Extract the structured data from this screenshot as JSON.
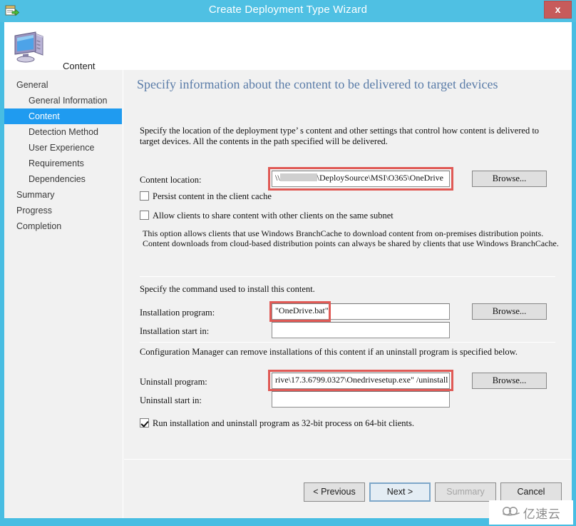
{
  "window": {
    "title": "Create Deployment Type Wizard",
    "title_icon": "deploy-package-icon",
    "close_label": "x"
  },
  "header": {
    "icon": "computer-monitor-icon",
    "label": "Content"
  },
  "sidebar": {
    "items": [
      {
        "label": "General",
        "level": 0,
        "selected": false
      },
      {
        "label": "General Information",
        "level": 1,
        "selected": false
      },
      {
        "label": "Content",
        "level": 1,
        "selected": true
      },
      {
        "label": "Detection Method",
        "level": 1,
        "selected": false
      },
      {
        "label": "User Experience",
        "level": 1,
        "selected": false
      },
      {
        "label": "Requirements",
        "level": 1,
        "selected": false
      },
      {
        "label": "Dependencies",
        "level": 1,
        "selected": false
      },
      {
        "label": "Summary",
        "level": 0,
        "selected": false
      },
      {
        "label": "Progress",
        "level": 0,
        "selected": false
      },
      {
        "label": "Completion",
        "level": 0,
        "selected": false
      }
    ]
  },
  "pane": {
    "title": "Specify information about the content to be delivered to target devices",
    "intro": "Specify the location of the deployment type’ s content and other settings that control how content is delivered to target devices. All the contents in the path specified will be delivered.",
    "content_location": {
      "label": "Content location:",
      "value_prefix": "\\\\",
      "value_suffix": "\\DeploySource\\MSI\\O365\\OneDrive",
      "browse_label": "Browse...",
      "highlighted": true
    },
    "persist_cache": {
      "label": "Persist content in the client cache",
      "checked": false
    },
    "share_subnet": {
      "label": "Allow clients to share content with other clients on the same subnet",
      "checked": false
    },
    "branchcache_help": "This option allows clients that use Windows BranchCache to download content from on-premises distribution points. Content downloads from cloud-based distribution points can always be shared by clients that use Windows BranchCache.",
    "install_section_help": "Specify the command used to install this content.",
    "installation_program": {
      "label": "Installation program:",
      "value": "\"OneDrive.bat\"",
      "browse_label": "Browse...",
      "highlighted": true
    },
    "installation_start_in": {
      "label": "Installation start in:",
      "value": "",
      "placeholder": ""
    },
    "uninstall_section_help": "Configuration Manager can remove installations of this content if an uninstall program is specified below.",
    "uninstall_program": {
      "label": "Uninstall program:",
      "value": "rive\\17.3.6799.0327\\Onedrivesetup.exe\" /uninstall",
      "browse_label": "Browse...",
      "highlighted": true
    },
    "uninstall_start_in": {
      "label": "Uninstall start in:",
      "value": "",
      "placeholder": ""
    },
    "run_32bit": {
      "label": "Run installation and uninstall program as 32-bit process on 64-bit clients.",
      "checked": true
    }
  },
  "footer": {
    "previous_label": "< Previous",
    "next_label": "Next >",
    "summary_label": "Summary",
    "cancel_label": "Cancel",
    "summary_disabled": true,
    "next_is_default": true
  },
  "watermark": {
    "icon": "cloud-logo-icon",
    "text": "亿速云"
  },
  "colors": {
    "titlebar": "#4fc0e3",
    "frame": "#48bde2",
    "selection": "#1f9bf0",
    "heading": "#5a7ca8",
    "annotation": "#e05a56",
    "close": "#c75b5b"
  }
}
